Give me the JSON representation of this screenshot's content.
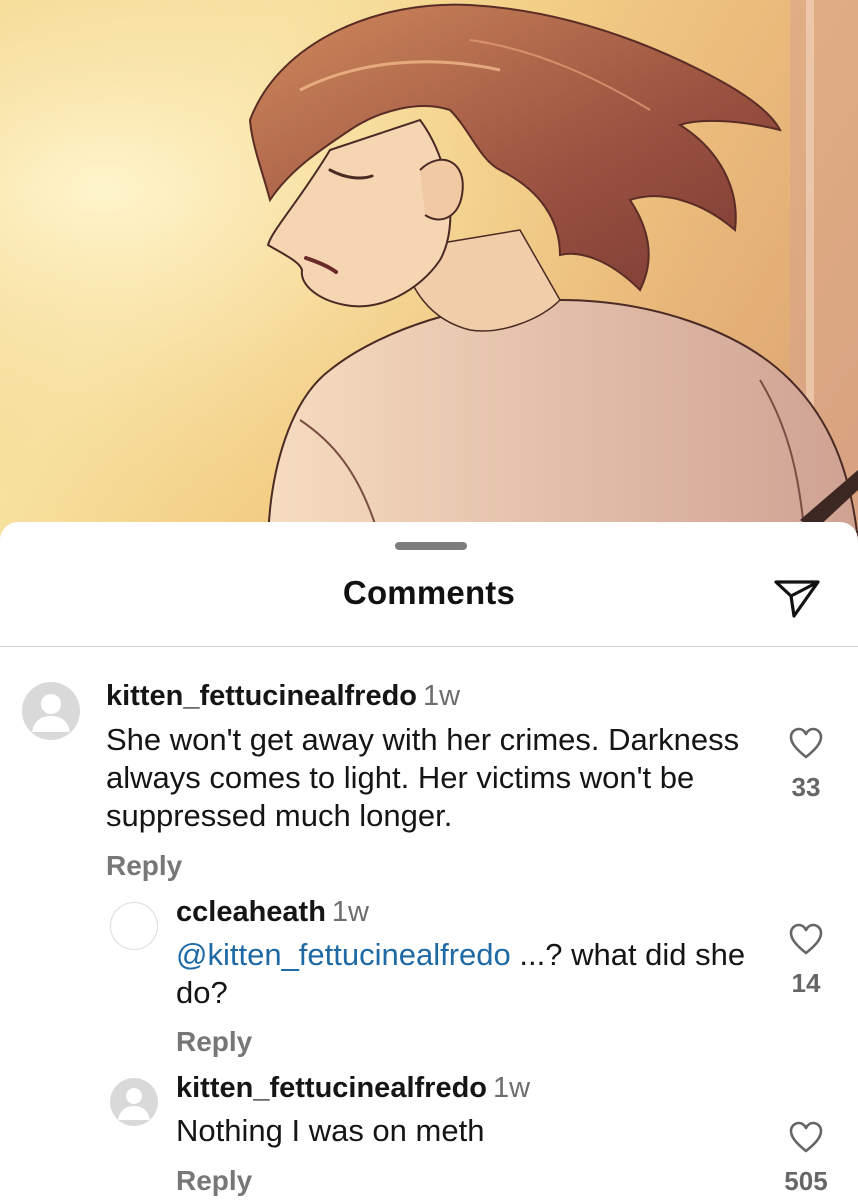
{
  "sheet": {
    "title": "Comments",
    "icons": {
      "share": "paper-plane-icon",
      "like": "heart-outline-icon",
      "avatar": "default-user-icon"
    }
  },
  "colors": {
    "mention": "#1f6aa5",
    "secondary_text": "#6e6e6e",
    "reply_text": "#777777"
  },
  "comments": [
    {
      "username": "kitten_fettucinealfredo",
      "time": "1w",
      "text": "She won't get away with her crimes. Darkness always comes to light. Her victims won't be suppressed much longer.",
      "likes": "33",
      "reply_label": "Reply"
    },
    {
      "username": "ccleaheath",
      "time": "1w",
      "mention": "@kitten_fettucinealfredo",
      "text": " ...? what did she do?",
      "likes": "14",
      "reply_label": "Reply"
    },
    {
      "username": "kitten_fettucinealfredo",
      "time": "1w",
      "text": "Nothing I was on meth",
      "likes": "505",
      "reply_label": "Reply"
    }
  ]
}
